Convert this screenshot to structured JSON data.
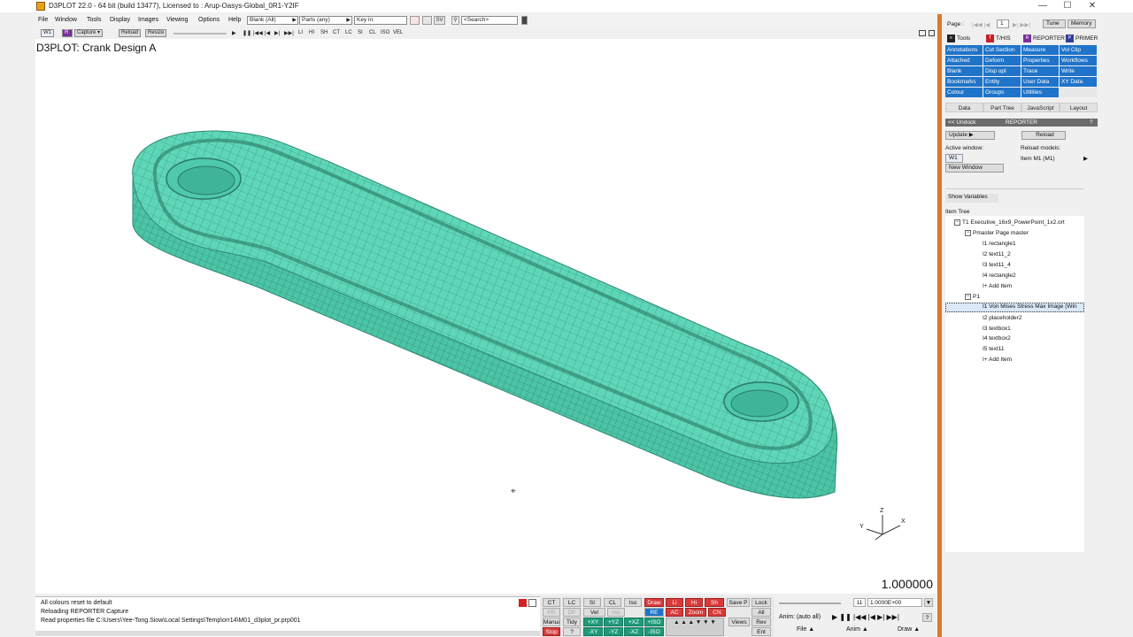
{
  "titlebar": {
    "title": "D3PLOT 22.0 - 64 bit (build 13477), Licensed to : Arup-Oasys-Global_0R1-Y2IF",
    "minimize": "—",
    "maximize": "☐",
    "close": "✕"
  },
  "menubar": {
    "items": [
      "File",
      "Window",
      "Tools",
      "Display",
      "Images",
      "Viewing",
      "Options",
      "Help"
    ],
    "blank_combo": "Blank (All)",
    "parts_combo": "Parts (any)",
    "keyin_label": "Key in:",
    "search_placeholder": "<Search>"
  },
  "win_toolbar": {
    "win": "W1",
    "capture": "Capture",
    "reload": "Reload",
    "resize": "Resize",
    "comps": [
      "LI",
      "HI",
      "SH",
      "CT",
      "LC",
      "SI",
      "CL",
      "ISO",
      "VEL"
    ]
  },
  "viewport": {
    "title": "D3PLOT: Crank Design A",
    "value": "1.000000",
    "axes": {
      "x": "X",
      "y": "Y",
      "z": "Z"
    }
  },
  "right_panel": {
    "page_label": "Page :",
    "page_value": "1",
    "tune": "Tune",
    "memory": "Memory",
    "tool_tabs": [
      "Tools",
      "T/HIS",
      "REPORTER",
      "PRIMER"
    ],
    "tool_grid": [
      [
        "Annotations",
        "Cut Section",
        "Measure",
        "Vol Clip"
      ],
      [
        "Attached",
        "Deform",
        "Properties",
        "Workflows"
      ],
      [
        "Blank",
        "Disp opt",
        "Trace",
        "Write"
      ],
      [
        "Bookmarks",
        "Entity",
        "User Data",
        "XY Data"
      ],
      [
        "Colour",
        "Groups",
        "Utilities",
        ""
      ]
    ],
    "sub_tabs": [
      "Data",
      "Part Tree",
      "JavaScript",
      "Layout"
    ],
    "undock": "<< Undock",
    "panel_name": "REPORTER",
    "help": "?",
    "update": "Update",
    "reload": "Reload",
    "active_window_label": "Active window:",
    "active_window": "W1",
    "reload_models_label": "Reload models:",
    "reload_models_value": "Item M1 (M1)",
    "new_window": "New Window",
    "show_variables": "Show Variables",
    "item_tree_label": "Item Tree",
    "tree": {
      "root": "T1 Executive_16x9_PowerPoint_1x2.ort",
      "master": "Pmaster Page master",
      "master_items": [
        "I1 rectangle1",
        "I2 text11_2",
        "I3 text11_4",
        "I4 rectangle2",
        "I+ Add Item"
      ],
      "p1": "P1",
      "p1_items": [
        "I1 Von Mises Stress Max Image (Win",
        "I2 placeholder2",
        "I3 textbox1",
        "I4 textbox2",
        "I5 text11",
        "I+ Add Item"
      ]
    }
  },
  "messages": [
    "All colours reset to default",
    "Reloading REPORTER Capture",
    "Read properties file C:\\Users\\Yee-Tong.Siow\\Local Settings\\Temp\\orr14\\M01_d3plot_pr.prp001"
  ],
  "controls": {
    "row1": [
      "CT",
      "LC",
      "SI",
      "CL",
      "Iso",
      "Draw",
      "Li",
      "Hi",
      "Sh",
      "Save P",
      "Lock"
    ],
    "row2": [
      "PR",
      "DP",
      "Vel",
      "Vec",
      "RE",
      "AC",
      "Zoom",
      "CN",
      "All"
    ],
    "row3": [
      "Manual",
      "Tidy",
      "+XY",
      "+YZ",
      "+XZ",
      "+ISO",
      "Views",
      "Rev"
    ],
    "row4": [
      "Stop",
      "?",
      "-XY",
      "-YZ",
      "-XZ",
      "-ISO",
      "Ent"
    ]
  },
  "anim": {
    "frame": "11",
    "time": "1.0000E+00",
    "label": "Anim: (auto all)",
    "help": "?",
    "menus": [
      "File",
      "Anim",
      "Draw"
    ]
  },
  "colors": {
    "mesh_fill": "#5fd6b8",
    "mesh_line": "#2f8a74",
    "accent_blue": "#1f74c9",
    "divider_orange": "#d97a2b"
  }
}
